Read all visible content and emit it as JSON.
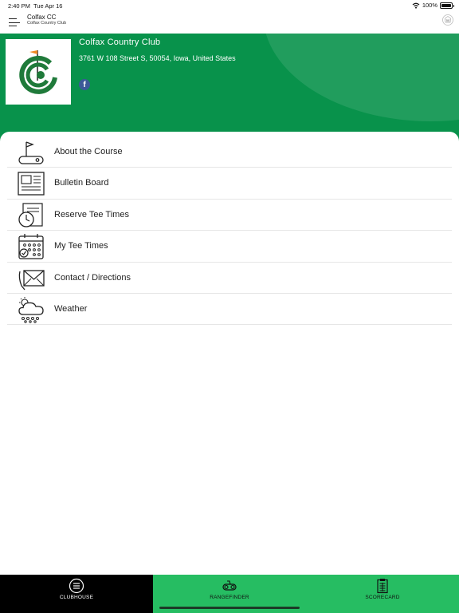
{
  "status": {
    "time": "2:40 PM",
    "date": "Tue Apr 16",
    "battery": "100%"
  },
  "header": {
    "title": "Colfax CC",
    "subtitle": "Colfax Country Club"
  },
  "club": {
    "name": "Colfax Country Club",
    "address": "3761 W 108 Street S, 50054, Iowa, United States",
    "social": "f"
  },
  "menu": [
    {
      "label": "About the Course",
      "icon": "golf-flag-icon"
    },
    {
      "label": "Bulletin Board",
      "icon": "newspaper-icon"
    },
    {
      "label": "Reserve Tee Times",
      "icon": "clock-calendar-icon"
    },
    {
      "label": "My Tee Times",
      "icon": "calendar-check-icon"
    },
    {
      "label": "Contact / Directions",
      "icon": "envelope-icon"
    },
    {
      "label": "Weather",
      "icon": "cloud-rain-icon"
    }
  ],
  "tabs": [
    {
      "label": "CLUBHOUSE",
      "icon": "list-circle-icon"
    },
    {
      "label": "RANGEFINDER",
      "icon": "golf-cart-icon"
    },
    {
      "label": "SCORECARD",
      "icon": "scorecard-icon"
    }
  ],
  "colors": {
    "brand_green": "#08924b",
    "tab_green": "#26bd62",
    "facebook": "#3b5998"
  }
}
